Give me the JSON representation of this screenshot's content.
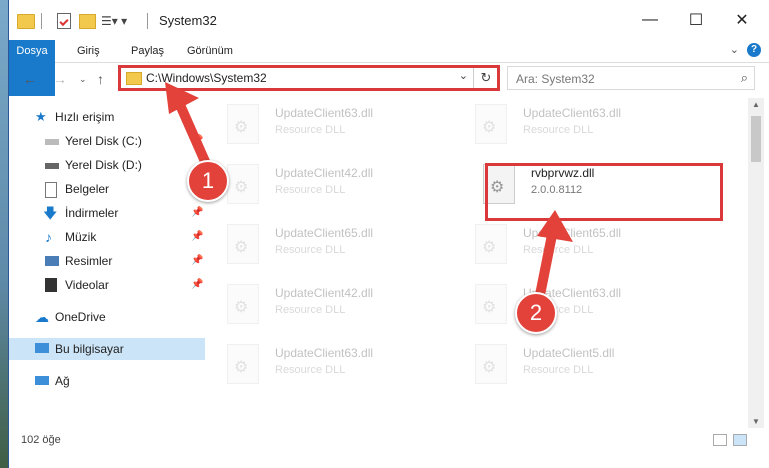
{
  "window": {
    "title": "System32"
  },
  "ribbon": {
    "tabs": [
      "Dosya",
      "Giriş",
      "Paylaş",
      "Görünüm"
    ]
  },
  "address": {
    "path": "C:\\Windows\\System32"
  },
  "search": {
    "placeholder": "Ara: System32"
  },
  "sidebar": {
    "items": [
      {
        "label": "Hızlı erişim",
        "icon": "star-icon"
      },
      {
        "label": "Yerel Disk (C:)",
        "icon": "drive-icon"
      },
      {
        "label": "Yerel Disk (D:)",
        "icon": "drive-icon"
      },
      {
        "label": "Belgeler",
        "icon": "documents-icon"
      },
      {
        "label": "İndirmeler",
        "icon": "download-icon"
      },
      {
        "label": "Müzik",
        "icon": "music-icon"
      },
      {
        "label": "Resimler",
        "icon": "pictures-icon"
      },
      {
        "label": "Videolar",
        "icon": "video-icon"
      },
      {
        "label": "OneDrive",
        "icon": "cloud-icon"
      },
      {
        "label": "Bu bilgisayar",
        "icon": "computer-icon"
      },
      {
        "label": "Ağ",
        "icon": "network-icon"
      }
    ]
  },
  "files": [
    {
      "name": "UpdateClient63.dll",
      "desc": "Resource DLL"
    },
    {
      "name": "UpdateClient63.dll",
      "desc": "Resource DLL"
    },
    {
      "name": "UpdateClient42.dll",
      "desc": "Resource DLL"
    },
    {
      "name": "rvbprvwz.dll",
      "desc": "2.0.0.8112"
    },
    {
      "name": "UpdateClient65.dll",
      "desc": "Resource DLL"
    },
    {
      "name": "UpdateClient65.dll",
      "desc": "Resource DLL"
    },
    {
      "name": "UpdateClient42.dll",
      "desc": "Resource DLL"
    },
    {
      "name": "UpdateClient63.dll",
      "desc": "Resource DLL"
    },
    {
      "name": "UpdateClient63.dll",
      "desc": "Resource DLL"
    },
    {
      "name": "UpdateClient5.dll",
      "desc": "Resource DLL"
    }
  ],
  "status": {
    "count": "102 öğe"
  },
  "annotations": {
    "step1": "1",
    "step2": "2"
  },
  "colors": {
    "accent": "#1979ca",
    "highlight": "#d9393a"
  }
}
